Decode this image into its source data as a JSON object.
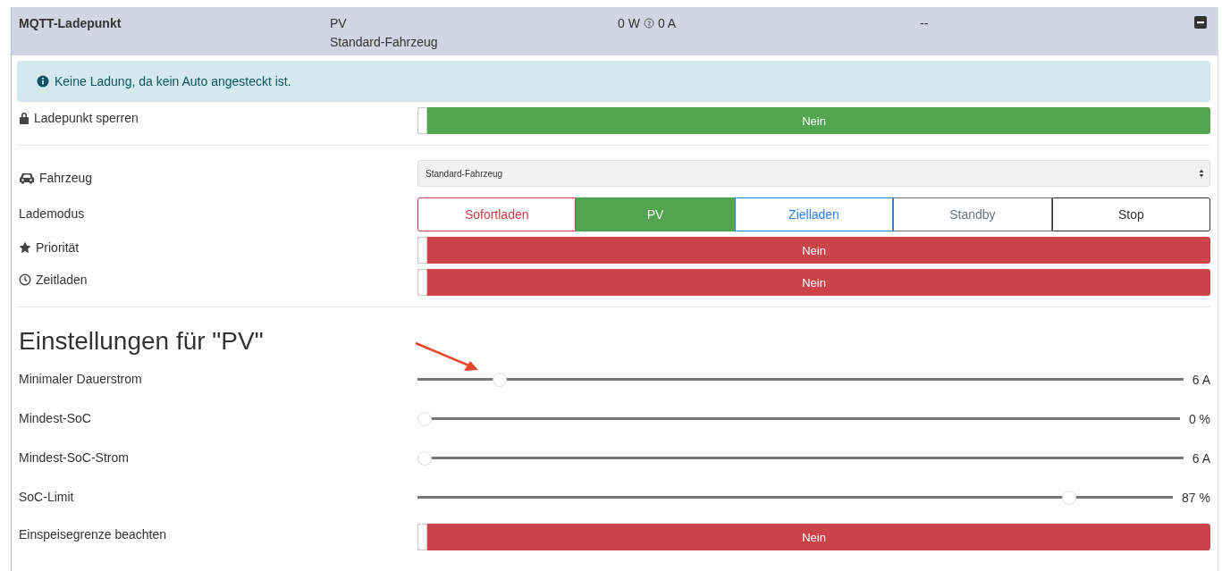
{
  "header": {
    "title": "MQTT-Ladepunkt",
    "mode": "PV",
    "vehicle": "Standard-Fahrzeug",
    "power": "0 W",
    "current": "0 A",
    "soc": "--"
  },
  "alert": {
    "text": "Keine Ladung, da kein Auto angesteckt ist."
  },
  "rows": [
    {
      "kind": "toggle",
      "label": "Ladepunkt sperren",
      "value": "Nein",
      "color": "#52a44f"
    },
    {
      "kind": "divider"
    },
    {
      "kind": "select",
      "label": "Fahrzeug",
      "value": "Standard-Fahrzeug"
    },
    {
      "kind": "segmented",
      "label": "Lademodus",
      "options": [
        {
          "label": "Sofortladen",
          "color": "#cc3c44",
          "selected": false
        },
        {
          "label": "PV",
          "color": "#52a44f",
          "selected": true
        },
        {
          "label": "Zielladen",
          "color": "#2f7ef2",
          "selected": false
        },
        {
          "label": "Standby",
          "color": "#6c757d",
          "selected": false
        },
        {
          "label": "Stop",
          "color": "#333333",
          "selected": false
        }
      ]
    },
    {
      "kind": "toggle",
      "label": "Priorität",
      "value": "Nein",
      "color": "#cc434a"
    },
    {
      "kind": "toggle",
      "label": "Zeitladen",
      "value": "Nein",
      "color": "#cc434a"
    },
    {
      "kind": "divider"
    },
    {
      "kind": "heading",
      "label": "Einstellungen für \"PV\""
    },
    {
      "kind": "slider",
      "label": "Minimaler Dauerstrom",
      "level": 0.1,
      "reading": "6 A"
    },
    {
      "kind": "slider",
      "label": "Mindest-SoC",
      "level": 0,
      "reading": "0 %"
    },
    {
      "kind": "slider",
      "label": "Mindest-SoC-Strom",
      "level": 0,
      "reading": "6 A"
    },
    {
      "kind": "slider",
      "label": "SoC-Limit",
      "level": 0.87,
      "reading": "87 %"
    },
    {
      "kind": "toggle",
      "label": "Einspeisegrenze beachten",
      "value": "Nein",
      "color": "#cc434a"
    }
  ]
}
